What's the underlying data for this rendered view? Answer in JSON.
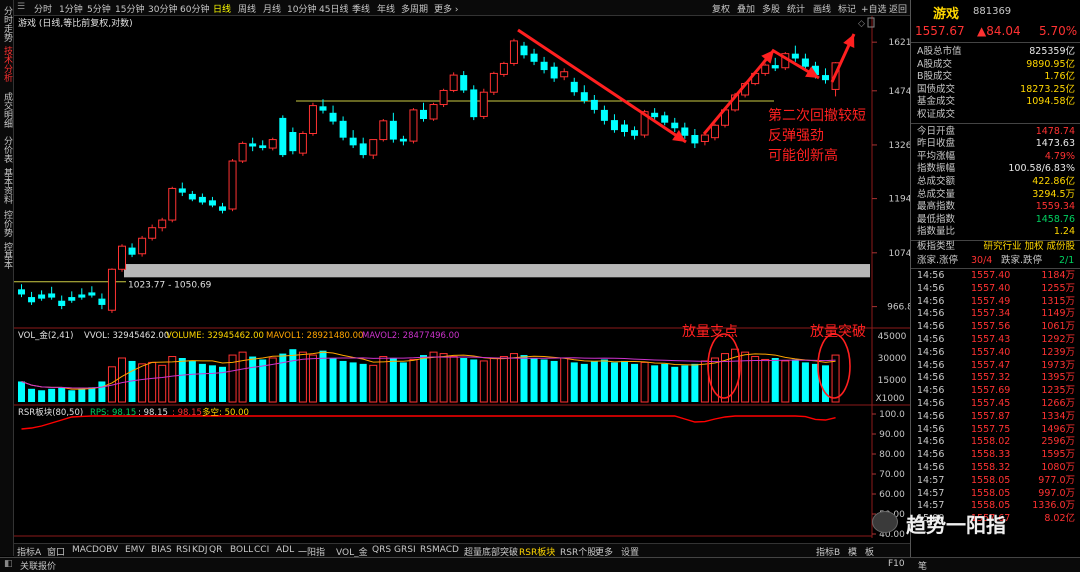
{
  "left_tabs": [
    {
      "label": "分时走势",
      "active": false
    },
    {
      "label": "技术分析",
      "active": true
    },
    {
      "label": "成交明细",
      "active": false
    },
    {
      "label": "分价表",
      "active": false
    },
    {
      "label": "基本资料",
      "active": false
    },
    {
      "label": "控价势",
      "active": false
    },
    {
      "label": "控基本",
      "active": false
    }
  ],
  "period_tabs": [
    "分时",
    "1分钟",
    "5分钟",
    "15分钟",
    "30分钟",
    "60分钟",
    "日线",
    "周线",
    "月线",
    "10分钟",
    "45日线",
    "季线",
    "年线",
    "多周期",
    "更多 ›"
  ],
  "active_period": "日线",
  "toolbar_right": [
    "复权",
    "叠加",
    "多股",
    "统计",
    "画线",
    "标记",
    "+自选",
    "返回"
  ],
  "chart_title": "游戏 (日线,等比前复权,对数)",
  "price_axis": [
    "1621",
    "1474",
    "1326",
    "1194",
    "1074",
    "966.8"
  ],
  "range_label": "1023.77 - 1050.69",
  "annotation_text": [
    "第二次回撤较短",
    "反弹强劲",
    "可能创新高"
  ],
  "vol_legend": {
    "name": "VOL_金(2,41)",
    "vvol": "VVOL: 32945462.00",
    "volume": "VOLUME: 32945462.00",
    "mavol1": "MAVOL1: 28921480.00",
    "mavol2": "MAVOL2: 28477496.00"
  },
  "vol_axis": [
    "45000",
    "30000",
    "15000",
    "X1000"
  ],
  "vol_annotations": [
    "放量支点",
    "放量突破"
  ],
  "rsr_legend": {
    "name": "RSR板块(80,50)",
    "rps": "RPS: 98.15",
    "v2": ": 98.15",
    "v3": ": 98.15",
    "more": "多空: 50.00"
  },
  "rsr_axis": [
    "100.0",
    "90.00",
    "80.00",
    "70.00",
    "60.00",
    "50.00",
    "40.00"
  ],
  "date_axis": {
    "year": "2023年",
    "m4": "4",
    "m5": "5",
    "date": "2023/05/05/五",
    "m6": "6"
  },
  "indicator_tabs": [
    "指标A",
    "窗口",
    "MACD",
    "OBV",
    "EMV",
    "BIAS",
    "RSI",
    "KDJ",
    "QR",
    "BOLL",
    "CCI",
    "ADL",
    "一阳指",
    "VOL_金",
    "QRS",
    "GRSI",
    "RSMACD",
    "超量底部突破",
    "RSR板块",
    "RSR个股",
    "更多",
    "设置"
  ],
  "active_indicator": "RSR板块",
  "indicator_right": [
    "指标B",
    "模",
    "板"
  ],
  "status_bar": {
    "left": "关联报价",
    "f10": "F10"
  },
  "watermark": "趋势一阳指",
  "quote": {
    "name": "游戏",
    "code": "881369",
    "price": "1557.67",
    "change": "▲84.04",
    "pct": "5.70%",
    "stats": [
      {
        "label": "A股总市值",
        "value": "825359亿",
        "color": "white"
      },
      {
        "label": "A股成交",
        "value": "9890.95亿",
        "color": "yellow"
      },
      {
        "label": "B股成交",
        "value": "1.76亿",
        "color": "yellow"
      },
      {
        "label": "国债成交",
        "value": "18273.25亿",
        "color": "yellow"
      },
      {
        "label": "基金成交",
        "value": "1094.58亿",
        "color": "yellow"
      },
      {
        "label": "权证成交",
        "value": "",
        "color": "yellow"
      },
      {
        "label": "今日开盘",
        "value": "1478.74",
        "color": "red"
      },
      {
        "label": "昨日收盘",
        "value": "1473.63",
        "color": "white"
      },
      {
        "label": "平均涨幅",
        "value": "4.79%",
        "color": "red"
      },
      {
        "label": "指数振幅",
        "value": "100.58/6.83%",
        "color": "white"
      },
      {
        "label": "总成交额",
        "value": "422.86亿",
        "color": "yellow"
      },
      {
        "label": "总成交量",
        "value": "3294.5万",
        "color": "yellow"
      },
      {
        "label": "最高指数",
        "value": "1559.34",
        "color": "red"
      },
      {
        "label": "最低指数",
        "value": "1458.76",
        "color": "green"
      },
      {
        "label": "指数量比",
        "value": "1.24",
        "color": "yellow"
      }
    ],
    "sector_type_label": "板指类型",
    "sector_type_value": "研究行业 加权 成份股",
    "updown": {
      "label1": "涨家.涨停",
      "value1": "30/4",
      "label2": "跌家.跌停",
      "value2": "2/1"
    },
    "ticks": [
      [
        "14:56",
        "1557.40",
        "1184万"
      ],
      [
        "14:56",
        "1557.40",
        "1255万"
      ],
      [
        "14:56",
        "1557.49",
        "1315万"
      ],
      [
        "14:56",
        "1557.34",
        "1149万"
      ],
      [
        "14:56",
        "1557.56",
        "1061万"
      ],
      [
        "14:56",
        "1557.43",
        "1292万"
      ],
      [
        "14:56",
        "1557.40",
        "1239万"
      ],
      [
        "14:56",
        "1557.47",
        "1973万"
      ],
      [
        "14:56",
        "1557.32",
        "1395万"
      ],
      [
        "14:56",
        "1557.69",
        "1235万"
      ],
      [
        "14:56",
        "1557.45",
        "1266万"
      ],
      [
        "14:56",
        "1557.87",
        "1334万"
      ],
      [
        "14:56",
        "1557.75",
        "1496万"
      ],
      [
        "14:56",
        "1558.02",
        "2596万"
      ],
      [
        "14:56",
        "1558.33",
        "1595万"
      ],
      [
        "14:56",
        "1558.32",
        "1080万"
      ],
      [
        "14:57",
        "1558.05",
        "977.0万"
      ],
      [
        "14:57",
        "1558.05",
        "997.0万"
      ],
      [
        "14:57",
        "1558.05",
        "1336.0万"
      ],
      [
        "15:00",
        "1557.67",
        "8.02亿"
      ]
    ]
  },
  "chart_data": {
    "type": "candlestick",
    "title": "游戏 (日线,等比前复权,对数)",
    "ylim": [
      940,
      1660
    ],
    "y_scale": "log",
    "y_ticks": [
      1621,
      1474,
      1326,
      1194,
      1074,
      966.8
    ],
    "candles": [
      [
        1000,
        1010,
        990,
        985
      ],
      [
        985,
        995,
        975,
        970
      ],
      [
        990,
        998,
        982,
        978
      ],
      [
        992,
        1005,
        984,
        980
      ],
      [
        978,
        988,
        968,
        962
      ],
      [
        985,
        996,
        978,
        974
      ],
      [
        990,
        1002,
        984,
        980
      ],
      [
        994,
        1006,
        988,
        984
      ],
      [
        982,
        992,
        970,
        962
      ],
      [
        960,
        1042,
        1040,
        955
      ],
      [
        1040,
        1092,
        1088,
        1035
      ],
      [
        1085,
        1094,
        1070,
        1065
      ],
      [
        1072,
        1110,
        1105,
        1066
      ],
      [
        1105,
        1135,
        1128,
        1100
      ],
      [
        1128,
        1150,
        1145,
        1120
      ],
      [
        1145,
        1222,
        1218,
        1140
      ],
      [
        1218,
        1232,
        1208,
        1200
      ],
      [
        1205,
        1212,
        1192,
        1188
      ],
      [
        1198,
        1206,
        1185,
        1180
      ],
      [
        1190,
        1198,
        1178,
        1174
      ],
      [
        1176,
        1184,
        1166,
        1160
      ],
      [
        1170,
        1290,
        1285,
        1165
      ],
      [
        1285,
        1335,
        1330,
        1280
      ],
      [
        1330,
        1345,
        1322,
        1310
      ],
      [
        1325,
        1338,
        1318,
        1312
      ],
      [
        1318,
        1345,
        1340,
        1312
      ],
      [
        1398,
        1405,
        1300,
        1295
      ],
      [
        1360,
        1372,
        1310,
        1302
      ],
      [
        1305,
        1362,
        1356,
        1298
      ],
      [
        1356,
        1440,
        1432,
        1350
      ],
      [
        1430,
        1450,
        1418,
        1410
      ],
      [
        1412,
        1432,
        1388,
        1380
      ],
      [
        1390,
        1402,
        1345,
        1338
      ],
      [
        1345,
        1365,
        1325,
        1318
      ],
      [
        1330,
        1345,
        1300,
        1292
      ],
      [
        1300,
        1320,
        1340,
        1290
      ],
      [
        1340,
        1395,
        1390,
        1335
      ],
      [
        1390,
        1412,
        1340,
        1332
      ],
      [
        1342,
        1350,
        1335,
        1325
      ],
      [
        1336,
        1425,
        1420,
        1330
      ],
      [
        1420,
        1440,
        1395,
        1388
      ],
      [
        1395,
        1440,
        1435,
        1390
      ],
      [
        1435,
        1480,
        1475,
        1428
      ],
      [
        1475,
        1528,
        1520,
        1470
      ],
      [
        1520,
        1532,
        1475,
        1468
      ],
      [
        1478,
        1490,
        1400,
        1392
      ],
      [
        1402,
        1480,
        1470,
        1395
      ],
      [
        1470,
        1530,
        1525,
        1462
      ],
      [
        1522,
        1560,
        1555,
        1515
      ],
      [
        1555,
        1632,
        1625,
        1548
      ],
      [
        1610,
        1622,
        1580,
        1570
      ],
      [
        1585,
        1600,
        1560,
        1550
      ],
      [
        1560,
        1575,
        1535,
        1525
      ],
      [
        1545,
        1558,
        1510,
        1500
      ],
      [
        1515,
        1540,
        1530,
        1505
      ],
      [
        1500,
        1512,
        1470,
        1460
      ],
      [
        1470,
        1490,
        1445,
        1438
      ],
      [
        1448,
        1462,
        1420,
        1410
      ],
      [
        1420,
        1432,
        1390,
        1380
      ],
      [
        1392,
        1408,
        1365,
        1358
      ],
      [
        1380,
        1392,
        1360,
        1348
      ],
      [
        1365,
        1375,
        1350,
        1340
      ],
      [
        1352,
        1420,
        1415,
        1345
      ],
      [
        1412,
        1425,
        1400,
        1390
      ],
      [
        1405,
        1415,
        1385,
        1378
      ],
      [
        1385,
        1398,
        1370,
        1360
      ],
      [
        1372,
        1385,
        1350,
        1342
      ],
      [
        1352,
        1368,
        1330,
        1318
      ],
      [
        1335,
        1348,
        1352,
        1325
      ],
      [
        1345,
        1382,
        1378,
        1338
      ],
      [
        1378,
        1425,
        1420,
        1372
      ],
      [
        1420,
        1468,
        1462,
        1415
      ],
      [
        1462,
        1500,
        1495,
        1455
      ],
      [
        1495,
        1530,
        1525,
        1490
      ],
      [
        1525,
        1555,
        1550,
        1518
      ],
      [
        1550,
        1572,
        1540,
        1532
      ],
      [
        1542,
        1590,
        1585,
        1535
      ],
      [
        1585,
        1610,
        1570,
        1560
      ],
      [
        1570,
        1585,
        1545,
        1538
      ],
      [
        1548,
        1560,
        1520,
        1510
      ],
      [
        1520,
        1540,
        1505,
        1495
      ],
      [
        1478,
        1559,
        1557,
        1458
      ]
    ],
    "volumes": [
      14000,
      9000,
      8000,
      9000,
      10000,
      8000,
      9000,
      10000,
      14000,
      24000,
      30000,
      28000,
      26000,
      27000,
      25000,
      31000,
      30000,
      28000,
      26000,
      25000,
      24000,
      32000,
      34000,
      31000,
      29000,
      30000,
      33000,
      36000,
      34000,
      32000,
      35000,
      30000,
      28000,
      27000,
      26000,
      25000,
      31000,
      30000,
      27000,
      29000,
      32000,
      34000,
      33000,
      31000,
      30000,
      29000,
      28000,
      30000,
      31000,
      33000,
      32000,
      30000,
      29000,
      28000,
      30000,
      27000,
      26000,
      28000,
      29000,
      27000,
      28000,
      26000,
      27000,
      25000,
      26000,
      24000,
      25000,
      26000,
      28000,
      30000,
      33000,
      36000,
      34000,
      31000,
      29000,
      30000,
      28000,
      29000,
      27000,
      26000,
      25000,
      32000
    ],
    "mavol1": 28921480,
    "mavol2": 28477496,
    "horizontal_lines": [
      1015,
      1445
    ],
    "range_box": [
      1023.77,
      1050.69
    ]
  },
  "colors": {
    "up": "#ff3232",
    "down": "#00ffff",
    "ma1": "#ffa500",
    "ma2": "#cc33cc",
    "rsr": "#ff0000",
    "hline": "#cccc44"
  }
}
